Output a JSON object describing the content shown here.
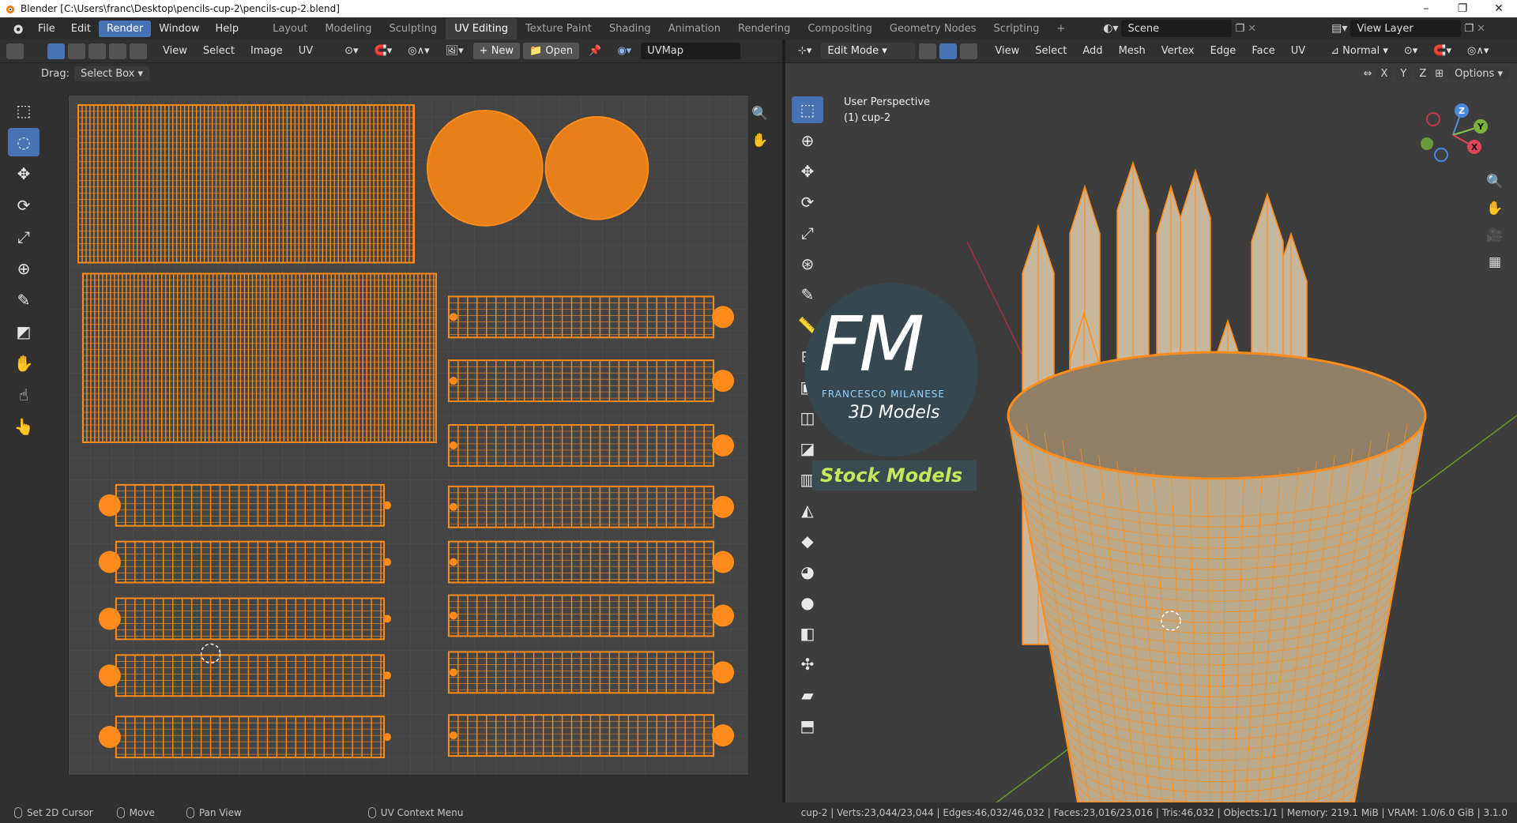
{
  "window": {
    "title": "Blender [C:\\Users\\franc\\Desktop\\pencils-cup-2\\pencils-cup-2.blend]",
    "controls": [
      "–",
      "❐",
      "✕"
    ]
  },
  "menubar": {
    "items": [
      "File",
      "Edit",
      "Render",
      "Window",
      "Help"
    ],
    "active": "Render"
  },
  "workspaces": {
    "tabs": [
      "Layout",
      "Modeling",
      "Sculpting",
      "UV Editing",
      "Texture Paint",
      "Shading",
      "Animation",
      "Rendering",
      "Compositing",
      "Geometry Nodes",
      "Scripting"
    ],
    "active": "UV Editing",
    "add": "+"
  },
  "scene": {
    "name": "Scene",
    "view_layer": "View Layer"
  },
  "uv_editor": {
    "header": {
      "menus": [
        "View",
        "Select",
        "Image",
        "UV"
      ],
      "new_label": "New",
      "open_label": "Open",
      "uvmap": "UVMap"
    },
    "drag_label": "Drag:",
    "drag_value": "Select Box"
  },
  "viewport": {
    "header": {
      "mode": "Edit Mode",
      "menus": [
        "View",
        "Select",
        "Add",
        "Mesh",
        "Vertex",
        "Edge",
        "Face",
        "UV"
      ],
      "orientation": "Normal",
      "options_label": "Options",
      "axes": [
        "X",
        "Y",
        "Z"
      ]
    },
    "perspective": "User Perspective",
    "object": "(1) cup-2",
    "gizmo": {
      "z": "Z",
      "y": "Y",
      "x": "X"
    }
  },
  "watermark": {
    "logo": "FM",
    "author": "FRANCESCO MILANESE",
    "tag": "3D Models",
    "banner": "Stock Models"
  },
  "statusbar": {
    "left": [
      {
        "label": "Set 2D Cursor"
      },
      {
        "label": "Move"
      },
      {
        "label": "Pan View"
      },
      {
        "label": "UV Context Menu"
      }
    ],
    "stats": "cup-2 | Verts:23,044/23,044 | Edges:46,032/46,032 | Faces:23,016/23,016 | Tris:46,032 | Objects:1/1 | Memory: 219.1 MiB | VRAM: 1.0/6.0 GiB | 3.1.0"
  },
  "colors": {
    "accent": "#4772b3",
    "selection": "#ff8c1a",
    "background": "#303030"
  }
}
